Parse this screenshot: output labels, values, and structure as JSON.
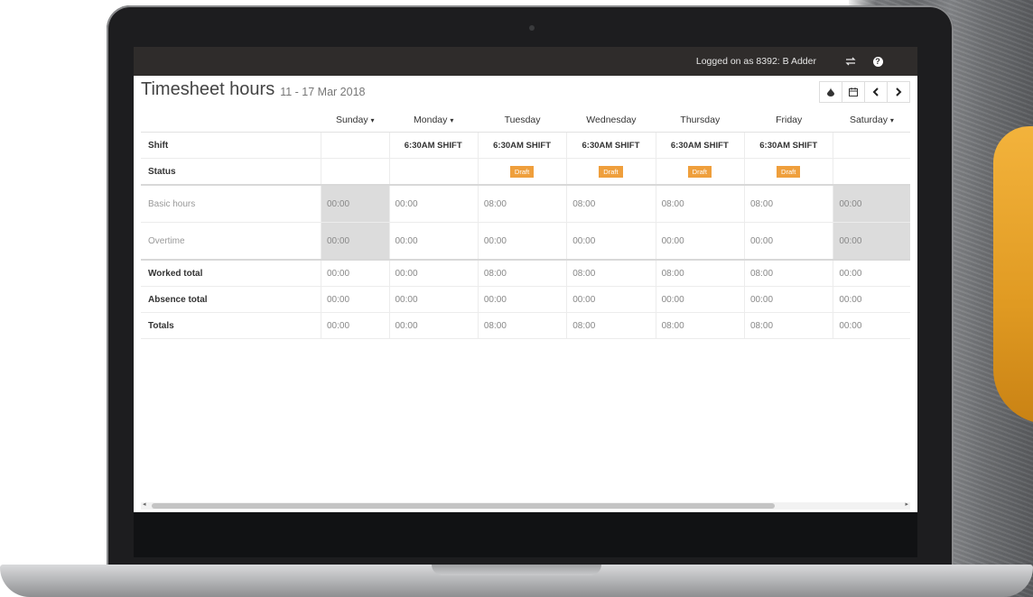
{
  "topbar": {
    "logged_on": "Logged on as 8392: B Adder",
    "swap_icon": "swap-icon",
    "help_icon": "help-icon"
  },
  "header": {
    "title": "Timesheet hours",
    "date_range": "11 - 17 Mar 2018",
    "toolbar_icons": [
      "drop-icon",
      "calendar-icon",
      "chevron-left-icon",
      "chevron-right-icon"
    ]
  },
  "table": {
    "days": [
      "Sunday",
      "Monday",
      "Tuesday",
      "Wednesday",
      "Thursday",
      "Friday",
      "Saturday"
    ],
    "day_has_dropdown": [
      true,
      true,
      false,
      false,
      false,
      false,
      true
    ],
    "rows": {
      "shift": {
        "label": "Shift",
        "values": [
          "",
          "6:30AM SHIFT",
          "6:30AM SHIFT",
          "6:30AM SHIFT",
          "6:30AM SHIFT",
          "6:30AM SHIFT",
          ""
        ]
      },
      "status": {
        "label": "Status",
        "values": [
          "",
          "",
          "Draft",
          "Draft",
          "Draft",
          "Draft",
          ""
        ]
      },
      "basic_hours": {
        "label": "Basic hours",
        "values": [
          "00:00",
          "00:00",
          "08:00",
          "08:00",
          "08:00",
          "08:00",
          "00:00"
        ]
      },
      "overtime": {
        "label": "Overtime",
        "values": [
          "00:00",
          "00:00",
          "00:00",
          "00:00",
          "00:00",
          "00:00",
          "00:00"
        ]
      },
      "worked_total": {
        "label": "Worked total",
        "values": [
          "00:00",
          "00:00",
          "08:00",
          "08:00",
          "08:00",
          "08:00",
          "00:00"
        ]
      },
      "absence_total": {
        "label": "Absence total",
        "values": [
          "00:00",
          "00:00",
          "00:00",
          "00:00",
          "00:00",
          "00:00",
          "00:00"
        ]
      },
      "totals": {
        "label": "Totals",
        "values": [
          "00:00",
          "00:00",
          "08:00",
          "08:00",
          "08:00",
          "08:00",
          "00:00"
        ]
      }
    }
  },
  "colors": {
    "topbar_bg": "#2f2c2b",
    "draft_badge": "#ef9f3c",
    "weekend_shade": "#dcdcdc"
  }
}
